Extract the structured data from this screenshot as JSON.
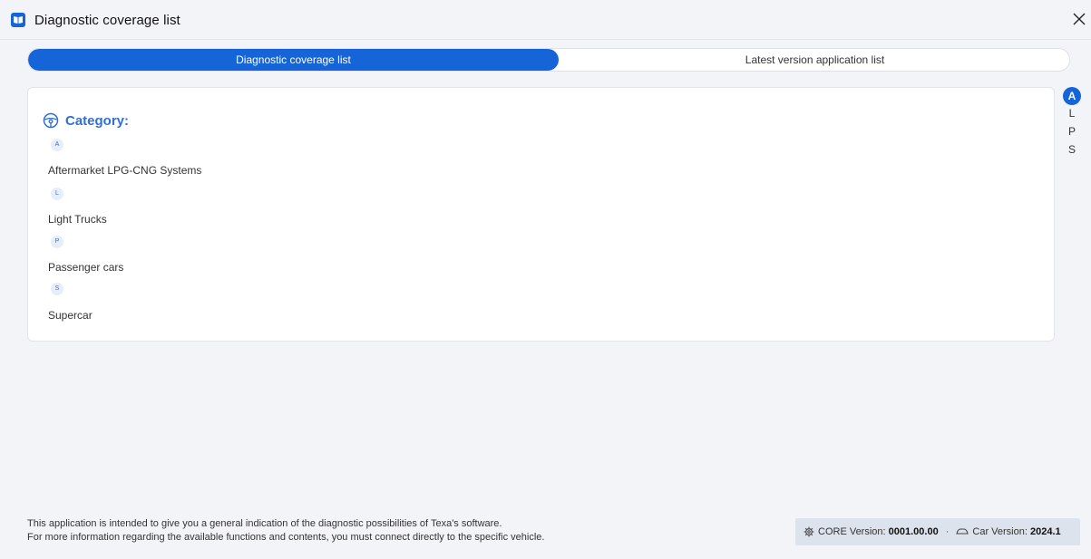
{
  "window": {
    "title": "Diagnostic coverage list"
  },
  "tabs": [
    {
      "label": "Diagnostic coverage list",
      "active": true
    },
    {
      "label": "Latest version application list",
      "active": false
    }
  ],
  "category": {
    "label": "Category:",
    "icon": "steering-wheel-icon",
    "groups": [
      {
        "letter": "A",
        "items": [
          "Aftermarket LPG-CNG Systems"
        ]
      },
      {
        "letter": "L",
        "items": [
          "Light Trucks"
        ]
      },
      {
        "letter": "P",
        "items": [
          "Passenger cars"
        ]
      },
      {
        "letter": "S",
        "items": [
          "Supercar"
        ]
      }
    ]
  },
  "index": {
    "letters": [
      "A",
      "L",
      "P",
      "S"
    ],
    "active": "A"
  },
  "footer": {
    "note_line1": "This application is intended to give you a general indication of the diagnostic possibilities of Texa's software.",
    "note_line2": "For more information regarding the available functions and contents, you must connect directly to the specific vehicle.",
    "core_label": "CORE Version:",
    "core_value": "0001.00.00",
    "separator": "·",
    "car_label": "Car Version:",
    "car_value": "2024.1"
  },
  "colors": {
    "accent": "#1565d8",
    "category_text": "#2f6fd6",
    "background": "#f3f4f7"
  }
}
